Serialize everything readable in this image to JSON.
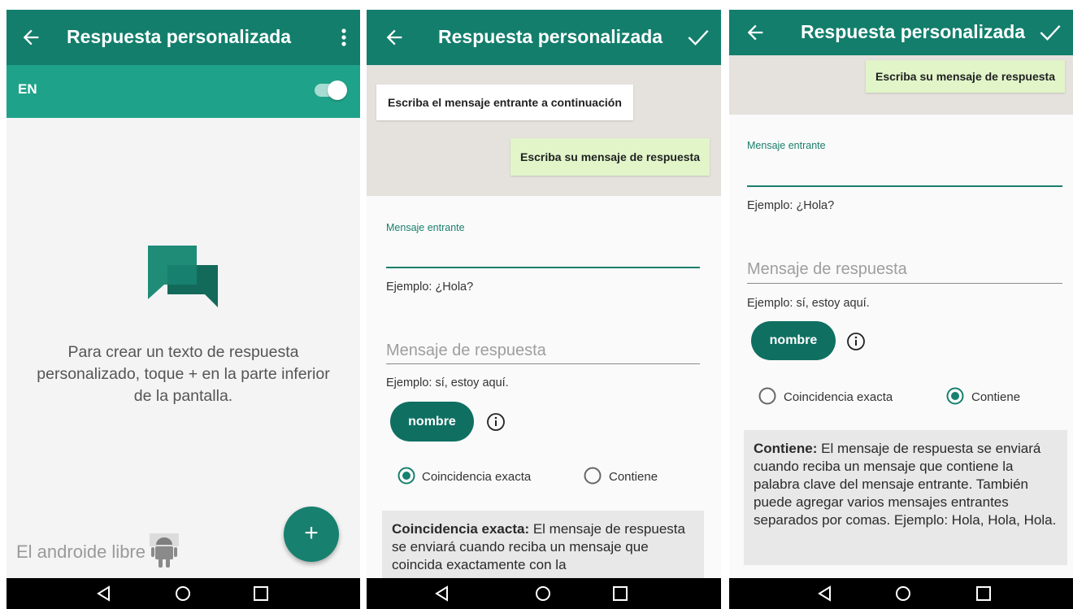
{
  "colors": {
    "primary": "#137e6c",
    "primary_light": "#1fa28a",
    "accent": "#0f7062",
    "reply_bubble": "#e1f5c9"
  },
  "screen1": {
    "title": "Respuesta personalizada",
    "toggle_label": "EN",
    "toggle_on": true,
    "empty_message": "Para crear un texto de respuesta personalizado, toque + en la parte inferior de la pantalla.",
    "fab_label": "+",
    "watermark": "El androide libre",
    "icons": {
      "back": "arrow-back-icon",
      "menu": "more-vert-icon",
      "empty": "chat-bubbles-icon"
    }
  },
  "screen2": {
    "title": "Respuesta personalizada",
    "incoming_bubble": "Escriba el mensaje entrante a continuación",
    "reply_bubble": "Escriba su mensaje de respuesta",
    "incoming_label": "Mensaje entrante",
    "incoming_hint": "Ejemplo: ¿Hola?",
    "reply_placeholder": "Mensaje de respuesta",
    "reply_hint": "Ejemplo: sí, estoy aquí.",
    "chip_label": "nombre",
    "radio_exact": "Coincidencia exacta",
    "radio_contains": "Contiene",
    "selected": "exact",
    "desc_title": "Coincidencia exacta:",
    "desc_text": " El mensaje de respuesta se enviará cuando reciba un mensaje que coincida exactamente con la"
  },
  "screen3": {
    "title": "Respuesta personalizada",
    "reply_bubble": "Escriba su mensaje de respuesta",
    "incoming_label": "Mensaje entrante",
    "incoming_hint": "Ejemplo: ¿Hola?",
    "reply_placeholder": "Mensaje de respuesta",
    "reply_hint": "Ejemplo: sí, estoy aquí.",
    "chip_label": "nombre",
    "radio_exact": "Coincidencia exacta",
    "radio_contains": "Contiene",
    "selected": "contains",
    "desc_title": "Contiene:",
    "desc_text": " El mensaje de respuesta se enviará cuando reciba un mensaje que contiene la palabra clave del mensaje entrante. También puede agregar varios mensajes entrantes separados por comas. Ejemplo: Hola, Hola, Hola."
  }
}
